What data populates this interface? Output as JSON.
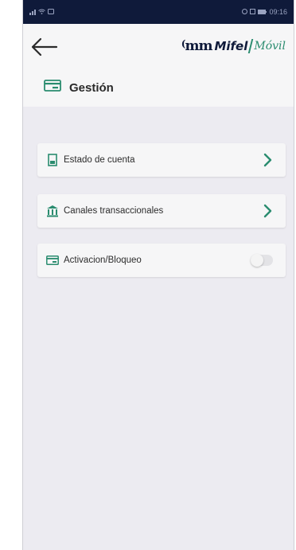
{
  "status_bar": {
    "left_icons": [
      "signal-icon",
      "wifi-icon",
      "notification-icon"
    ],
    "right_icons": [
      "alarm-icon",
      "nfc-icon",
      "battery-icon"
    ],
    "time": "09:16"
  },
  "header": {
    "logo_mark": "m",
    "logo_brand": "Mifel",
    "logo_sub": "Móvil",
    "section_title": "Gestión",
    "section_icon": "card-icon"
  },
  "menu": {
    "items": [
      {
        "label": "Estado de cuenta",
        "icon": "document-icon",
        "control": "chevron"
      },
      {
        "label": "Canales transaccionales",
        "icon": "bank-icon",
        "control": "chevron"
      },
      {
        "label": "Activacion/Bloqueo",
        "icon": "card-icon",
        "control": "toggle",
        "toggle_on": false
      }
    ]
  },
  "colors": {
    "accent": "#2a8c6f",
    "navy": "#0f1a3a",
    "background": "#ecebf1",
    "card": "#f6f6f7"
  }
}
